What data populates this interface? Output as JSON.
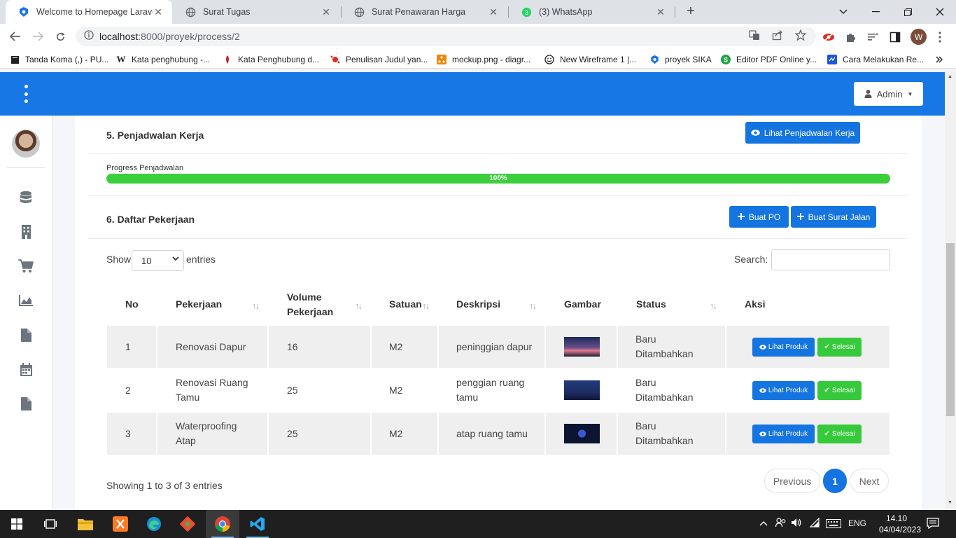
{
  "browser": {
    "tabs": [
      {
        "title": "Welcome to Homepage Laravel",
        "active": true
      },
      {
        "title": "Surat Tugas",
        "active": false
      },
      {
        "title": "Surat Penawaran Harga",
        "active": false
      },
      {
        "title": "(3) WhatsApp",
        "active": false,
        "badge": "3"
      }
    ],
    "url_host": "localhost",
    "url_path": ":8000/proyek/process/2",
    "profile_initial": "W",
    "bookmarks": [
      "Tanda Koma (,) - PU...",
      "Kata penghubung -...",
      "Kata Penghubung d...",
      "Penulisan Judul yan...",
      "mockup.png - diagr...",
      "New Wireframe 1 |...",
      "proyek SIKA",
      "Editor PDF Online y...",
      "Cara Melakukan Re..."
    ]
  },
  "app": {
    "brand_color": "#1777e5",
    "user_menu": "Admin",
    "sidebar_icons": [
      "database-icon",
      "building-icon",
      "cart-icon",
      "chart-area-icon",
      "file-icon",
      "calendar-icon",
      "file-alt-icon"
    ]
  },
  "schedule": {
    "title": "5. Penjadwalan Kerja",
    "view_button": "Lihat Penjadwalan Kerja",
    "progress_label": "Progress Penjadwalan",
    "progress_value": 100,
    "progress_text": "100%"
  },
  "jobs": {
    "title": "6. Daftar Pekerjaan",
    "buttons": {
      "po": "Buat PO",
      "surat_jalan": "Buat Surat Jalan"
    },
    "show_label": "Show",
    "entries_value": "10",
    "entries_label": "entries",
    "search_label": "Search:",
    "columns": {
      "no": "No",
      "pekerjaan": "Pekerjaan",
      "volume": "Volume Pekerjaan",
      "satuan": "Satuan",
      "deskripsi": "Deskripsi",
      "gambar": "Gambar",
      "status": "Status",
      "aksi": "Aksi"
    },
    "rows": [
      {
        "no": "1",
        "pekerjaan": "Renovasi Dapur",
        "volume": "16",
        "satuan": "M2",
        "deskripsi": "peninggian dapur",
        "status": "Baru Ditambahkan",
        "btn_view": "Lihat Produk",
        "btn_done": "Selesai"
      },
      {
        "no": "2",
        "pekerjaan": "Renovasi Ruang Tamu",
        "volume": "25",
        "satuan": "M2",
        "deskripsi": "penggian ruang tamu",
        "status": "Baru Ditambahkan",
        "btn_view": "Lihat Produk",
        "btn_done": "Selesai"
      },
      {
        "no": "3",
        "pekerjaan": "Waterproofing Atap",
        "volume": "25",
        "satuan": "M2",
        "deskripsi": "atap ruang tamu",
        "status": "Baru Ditambahkan",
        "btn_view": "Lihat Produk",
        "btn_done": "Selesai"
      }
    ],
    "info": "Showing 1 to 3 of 3 entries",
    "pagination": {
      "prev": "Previous",
      "page": "1",
      "next": "Next"
    }
  },
  "taskbar": {
    "language": "ENG",
    "time": "14.10",
    "date": "04/04/2023"
  }
}
